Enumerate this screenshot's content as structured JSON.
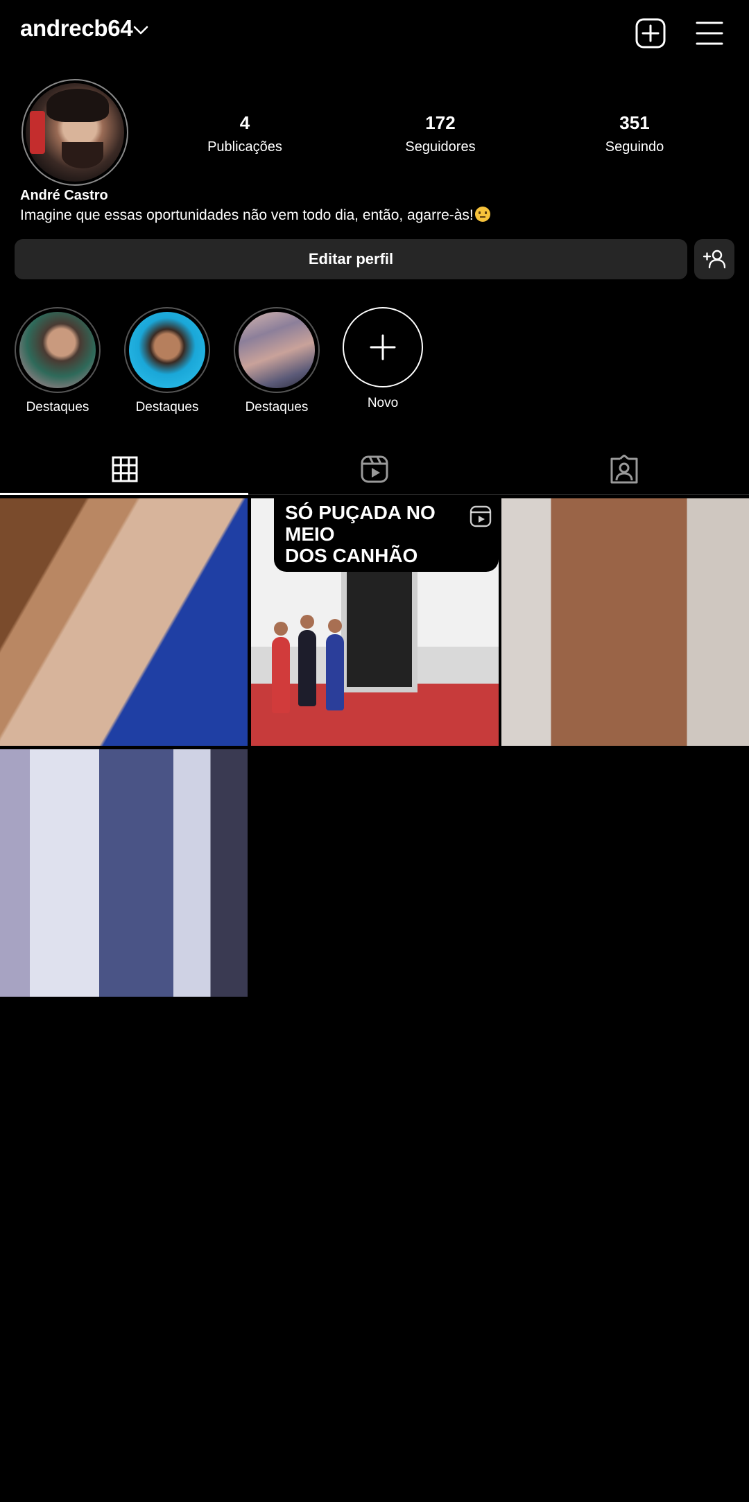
{
  "header": {
    "username": "andrecb64"
  },
  "profile": {
    "full_name": "André Castro",
    "bio": "Imagine que essas oportunidades não vem todo dia, então, agarre-às!",
    "stats": [
      {
        "value": "4",
        "label": "Publicações"
      },
      {
        "value": "172",
        "label": "Seguidores"
      },
      {
        "value": "351",
        "label": "Seguindo"
      }
    ]
  },
  "actions": {
    "edit_profile": "Editar perfil"
  },
  "highlights": [
    {
      "label": "Destaques"
    },
    {
      "label": "Destaques"
    },
    {
      "label": "Destaques"
    },
    {
      "label": "Novo"
    }
  ],
  "posts": [
    {
      "type": "photo"
    },
    {
      "type": "reel",
      "caption_line1": "SÓ PUÇADA NO MEIO",
      "caption_line2": "DOS CANHÃO"
    },
    {
      "type": "photo"
    },
    {
      "type": "photo"
    }
  ],
  "tabs": [
    {
      "icon": "grid-icon",
      "active": true
    },
    {
      "icon": "reels-icon",
      "active": false
    },
    {
      "icon": "tagged-icon",
      "active": false
    }
  ],
  "colors": {
    "background": "#000000",
    "button": "#262626",
    "text": "#ffffff"
  }
}
